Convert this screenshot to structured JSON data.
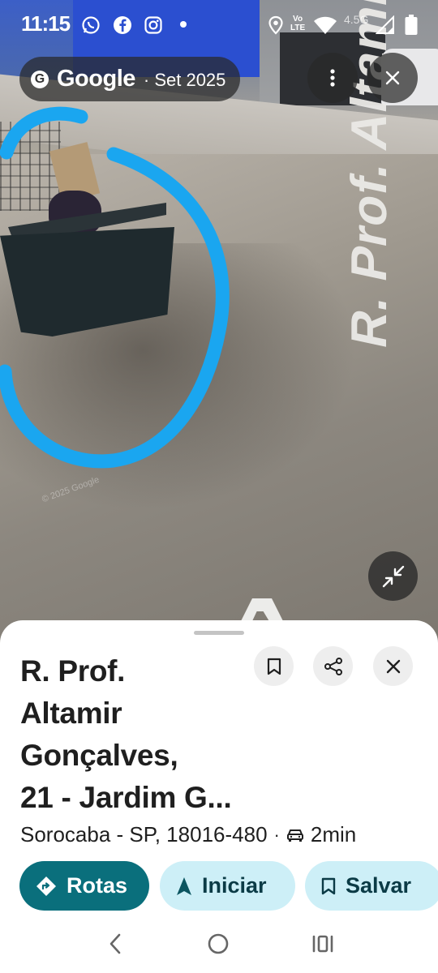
{
  "status_bar": {
    "time": "11:15",
    "network_type": "4.5G",
    "vo_lte_top": "Vo",
    "vo_lte_bottom": "LTE",
    "icons": [
      "whatsapp-icon",
      "facebook-icon",
      "instagram-icon",
      "location-icon",
      "wifi-icon",
      "signal-icon",
      "battery-icon"
    ]
  },
  "street_view": {
    "brand": "Google",
    "date": "· Set 2025",
    "road_text": "R. Prof. Altamir",
    "watermark": "© 2025 Google"
  },
  "place": {
    "title_lines": [
      "R. Prof.",
      "Altamir",
      "Gonçalves,",
      "21 - Jardim G..."
    ],
    "address": "Sorocaba - SP, 18016-480",
    "separator": "·",
    "travel_time": "2min"
  },
  "actions": {
    "routes_label": "Rotas",
    "start_label": "Iniciar",
    "save_label": "Salvar"
  },
  "colors": {
    "accent_teal": "#0a6f7c",
    "chip_light": "#cdeff7",
    "annotation_blue": "#1aa6f0"
  }
}
